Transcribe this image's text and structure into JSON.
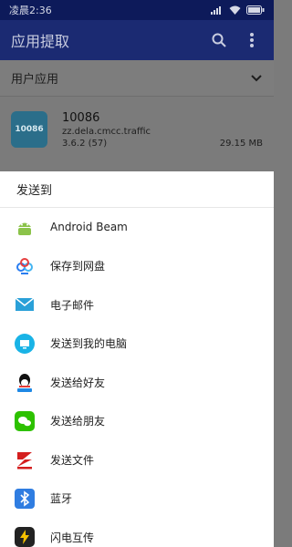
{
  "status": {
    "time": "凌晨2:36"
  },
  "appbar": {
    "title": "应用提取"
  },
  "section": {
    "title": "用户应用"
  },
  "app": {
    "icon_text": "10086",
    "name": "10086",
    "package": "zz.dela.cmcc.traffic",
    "version": "3.6.2 (57)",
    "size": "29.15 MB"
  },
  "sheet": {
    "title": "发送到",
    "items": [
      {
        "label": "Android Beam",
        "icon": "android-icon",
        "color": "#8bc34a"
      },
      {
        "label": "保存到网盘",
        "icon": "cloud-drive-icon",
        "color": "#2a7df0"
      },
      {
        "label": "电子邮件",
        "icon": "email-icon",
        "color": "#2aa0d8"
      },
      {
        "label": "发送到我的电脑",
        "icon": "computer-icon",
        "color": "#19b3e6"
      },
      {
        "label": "发送给好友",
        "icon": "qq-icon",
        "color": "#111111"
      },
      {
        "label": "发送给朋友",
        "icon": "wechat-icon",
        "color": "#2dc100"
      },
      {
        "label": "发送文件",
        "icon": "file-transfer-icon",
        "color": "#d41f1f"
      },
      {
        "label": "蓝牙",
        "icon": "bluetooth-icon",
        "color": "#2f7de1"
      },
      {
        "label": "闪电互传",
        "icon": "flash-transfer-icon",
        "color": "#f6c000"
      }
    ]
  }
}
